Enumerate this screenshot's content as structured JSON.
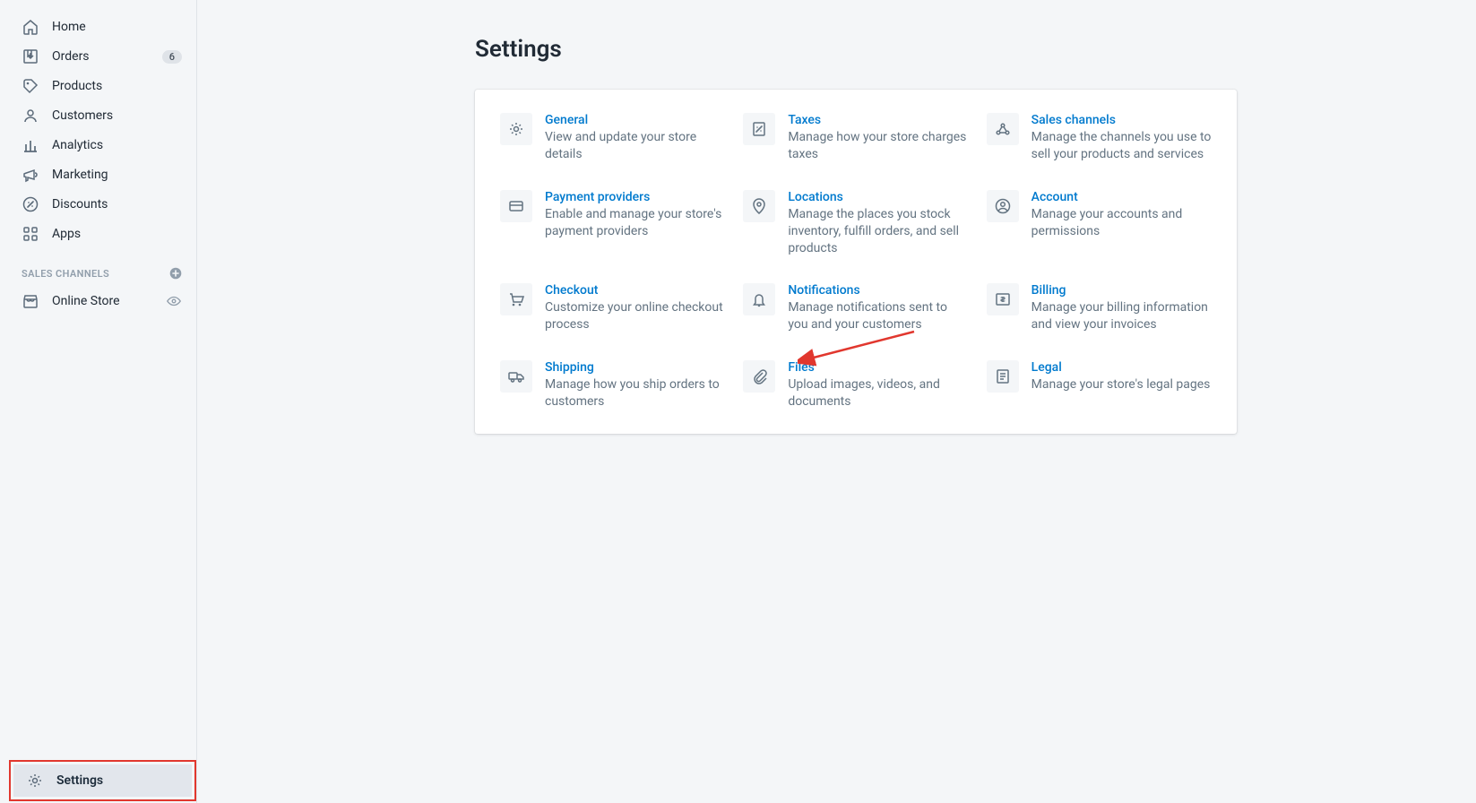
{
  "sidebar": {
    "items": [
      {
        "label": "Home",
        "icon": "home"
      },
      {
        "label": "Orders",
        "icon": "orders",
        "badge": "6"
      },
      {
        "label": "Products",
        "icon": "products"
      },
      {
        "label": "Customers",
        "icon": "customers"
      },
      {
        "label": "Analytics",
        "icon": "analytics"
      },
      {
        "label": "Marketing",
        "icon": "marketing"
      },
      {
        "label": "Discounts",
        "icon": "discounts"
      },
      {
        "label": "Apps",
        "icon": "apps"
      }
    ],
    "channels_label": "SALES CHANNELS",
    "channels": [
      {
        "label": "Online Store",
        "icon": "online-store"
      }
    ],
    "settings_label": "Settings"
  },
  "page": {
    "title": "Settings"
  },
  "settings": [
    {
      "title": "General",
      "desc": "View and update your store details",
      "icon": "gear"
    },
    {
      "title": "Taxes",
      "desc": "Manage how your store charges taxes",
      "icon": "receipt"
    },
    {
      "title": "Sales channels",
      "desc": "Manage the channels you use to sell your products and services",
      "icon": "channels"
    },
    {
      "title": "Payment providers",
      "desc": "Enable and manage your store's payment providers",
      "icon": "card"
    },
    {
      "title": "Locations",
      "desc": "Manage the places you stock inventory, fulfill orders, and sell products",
      "icon": "location"
    },
    {
      "title": "Account",
      "desc": "Manage your accounts and permissions",
      "icon": "account"
    },
    {
      "title": "Checkout",
      "desc": "Customize your online checkout process",
      "icon": "cart"
    },
    {
      "title": "Notifications",
      "desc": "Manage notifications sent to you and your customers",
      "icon": "bell"
    },
    {
      "title": "Billing",
      "desc": "Manage your billing information and view your invoices",
      "icon": "billing"
    },
    {
      "title": "Shipping",
      "desc": "Manage how you ship orders to customers",
      "icon": "truck"
    },
    {
      "title": "Files",
      "desc": "Upload images, videos, and documents",
      "icon": "clip"
    },
    {
      "title": "Legal",
      "desc": "Manage your store's legal pages",
      "icon": "legal"
    }
  ]
}
